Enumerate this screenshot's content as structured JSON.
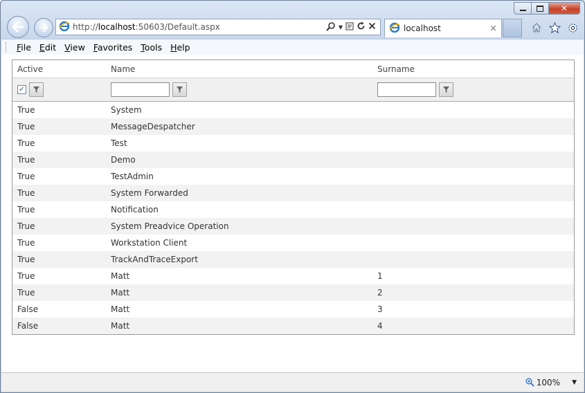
{
  "browser": {
    "url_prefix": "http://",
    "url_host": "localhost",
    "url_rest": ":50603/Default.aspx",
    "tab_title": "localhost",
    "tab_close": "×",
    "icons": [
      "back-icon",
      "forward-icon",
      "ie-logo-icon",
      "search-icon",
      "compat-view-icon",
      "refresh-icon",
      "stop-icon",
      "home-icon",
      "favorites-star-icon",
      "gear-icon"
    ]
  },
  "window_controls": {
    "close": "✕"
  },
  "menu": [
    {
      "label": "File",
      "u": "F",
      "rest": "ile"
    },
    {
      "label": "Edit",
      "u": "E",
      "rest": "dit"
    },
    {
      "label": "View",
      "u": "V",
      "rest": "iew"
    },
    {
      "label": "Favorites",
      "u": "F",
      "rest": "avorites"
    },
    {
      "label": "Tools",
      "u": "T",
      "rest": "ools"
    },
    {
      "label": "Help",
      "u": "H",
      "rest": "elp"
    }
  ],
  "grid": {
    "columns": [
      "Active",
      "Name",
      "Surname"
    ],
    "filter": {
      "active_checked": true,
      "active_check_glyph": "✓",
      "name_value": "",
      "surname_value": ""
    },
    "rows": [
      {
        "active": "True",
        "name": "System",
        "surname": ""
      },
      {
        "active": "True",
        "name": "MessageDespatcher",
        "surname": ""
      },
      {
        "active": "True",
        "name": "Test",
        "surname": ""
      },
      {
        "active": "True",
        "name": "Demo",
        "surname": ""
      },
      {
        "active": "True",
        "name": "TestAdmin",
        "surname": ""
      },
      {
        "active": "True",
        "name": "System Forwarded",
        "surname": ""
      },
      {
        "active": "True",
        "name": "Notification",
        "surname": ""
      },
      {
        "active": "True",
        "name": "System Preadvice Operation",
        "surname": ""
      },
      {
        "active": "True",
        "name": "Workstation Client",
        "surname": ""
      },
      {
        "active": "True",
        "name": "TrackAndTraceExport",
        "surname": ""
      },
      {
        "active": "True",
        "name": "Matt",
        "surname": "1"
      },
      {
        "active": "True",
        "name": "Matt",
        "surname": "2"
      },
      {
        "active": "False",
        "name": "Matt",
        "surname": "3"
      },
      {
        "active": "False",
        "name": "Matt",
        "surname": "4"
      }
    ]
  },
  "status": {
    "zoom": "100%",
    "zoom_dropdown": "▼"
  },
  "colors": {
    "accent": "#1a5fb4",
    "row_alt": "#f2f2f2",
    "filter_bg": "#f0f0f0"
  }
}
